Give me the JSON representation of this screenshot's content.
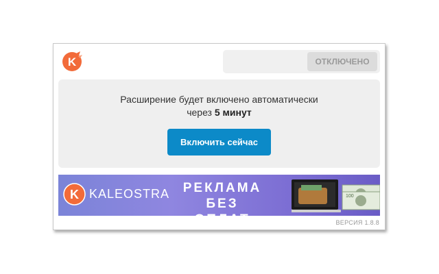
{
  "header": {
    "toggle_label": "ОТКЛЮЧЕНО"
  },
  "notice": {
    "line1": "Расширение будет включено автоматически",
    "line2_prefix": "через ",
    "line2_bold": "5 минут",
    "button_label": "Включить сейчас"
  },
  "banner": {
    "brand": "KALEOSTRA",
    "ad_line1": "РЕКЛАМА",
    "ad_line2": "БЕЗ ОПЛАТ"
  },
  "footer": {
    "version": "ВЕРСИЯ 1.8.8"
  },
  "colors": {
    "accent": "#0c8ac8",
    "logo_orange": "#f26b3a",
    "banner_purple": "#8f86e0"
  }
}
